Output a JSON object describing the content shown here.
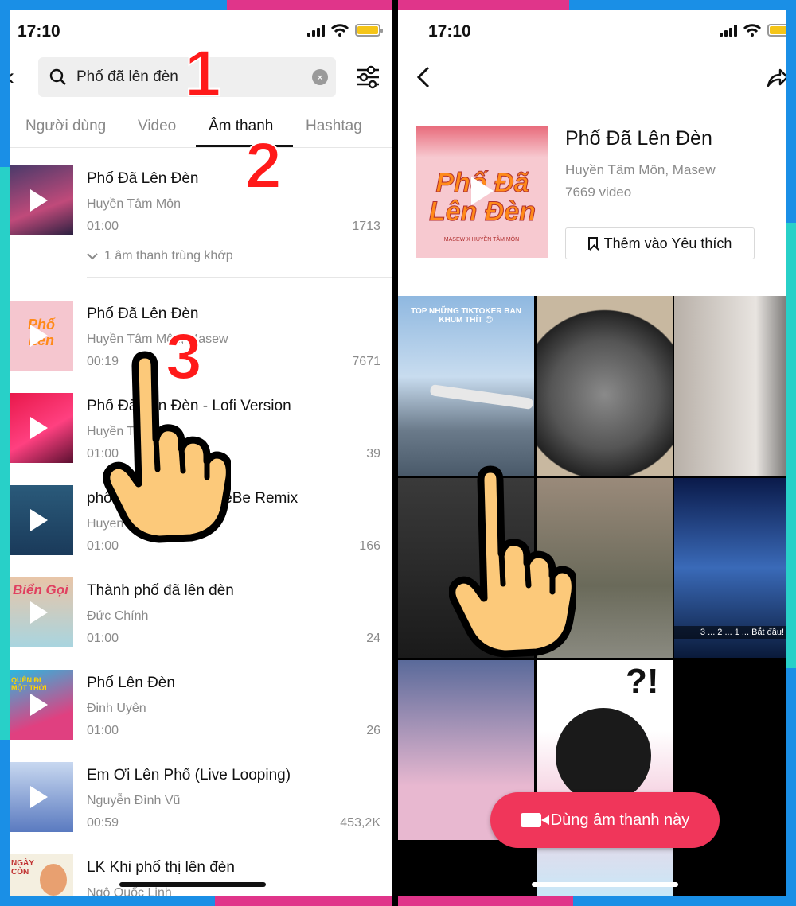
{
  "left_screen": {
    "status_time": "17:10",
    "search": {
      "value": "Phố đã lên đèn"
    },
    "tabs": [
      {
        "label": "Người dùng"
      },
      {
        "label": "Video"
      },
      {
        "label": "Âm thanh",
        "active": true
      },
      {
        "label": "Hashtag"
      }
    ],
    "results": [
      {
        "title": "Phố Đã Lên Đèn",
        "artist": "Huyền Tâm Môn",
        "duration": "01:00",
        "count": "1713"
      },
      {
        "title": "Phố Đã Lên Đèn",
        "artist": "Huyền Tâm Môn, Masew",
        "duration": "00:19",
        "count": "7671"
      },
      {
        "title": "Phố Đã Lên Đèn - Lofi Version",
        "artist": "Huyền Tâm Môn",
        "duration": "01:00",
        "count": "39"
      },
      {
        "title": "phố đã lên đèn - JuseBe Remix",
        "artist": "Huyen Tam Mon",
        "duration": "01:00",
        "count": "166"
      },
      {
        "title": "Thành phố đã lên đèn",
        "artist": "Đức Chính",
        "duration": "01:00",
        "count": "24"
      },
      {
        "title": "Phố Lên Đèn",
        "artist": "Đinh Uyên",
        "duration": "01:00",
        "count": "26"
      },
      {
        "title": "Em Ơi Lên Phố (Live Looping)",
        "artist": "Nguyễn Đình Vũ",
        "duration": "00:59",
        "count": "453,2K"
      },
      {
        "title": "LK Khi phố thị lên đèn",
        "artist": "Ngô Quốc Linh",
        "duration": "",
        "count": ""
      }
    ],
    "match_label": "1 âm thanh trùng khớp",
    "thumb_text": {
      "bien_goi": "Biển Gọi",
      "quen_di": "QUÊN ĐI MỘT THỜI",
      "ngay_con": "NGÀY CÒN"
    },
    "steps": [
      "1",
      "2",
      "3"
    ]
  },
  "right_screen": {
    "status_time": "17:10",
    "sound": {
      "title": "Phố Đã Lên Đèn",
      "artists": "Huyền Tâm Môn, Masew",
      "video_count": "7669 video",
      "cover_text": "Phố Đã Lên Đèn",
      "cover_sub": "MASEW X HUYỀN TÂM MÔN"
    },
    "favorite_label": "Thêm vào Yêu thích",
    "grid": {
      "caption_1": "TOP NHỮNG TIKTOKER BAN KHUM THÍT 😊",
      "caption_6": "3 ... 2 ... 1 ... Bắt đầu!",
      "caption_8": "?!"
    },
    "use_sound_label": "Dùng âm thanh này"
  },
  "colors": {
    "frame_blue": "#1a8fe6",
    "frame_pink": "#e0358a",
    "frame_cyan": "#28d0c8",
    "step_red": "#ff1a1a",
    "use_button": "#f0365a",
    "battery": "#f5c518"
  },
  "icons": [
    "search-icon",
    "clear-icon",
    "filter-icon",
    "back-arrow-icon",
    "share-icon",
    "bookmark-icon",
    "camera-icon",
    "play-icon",
    "chevron-down-icon",
    "pointing-hand-icon"
  ]
}
